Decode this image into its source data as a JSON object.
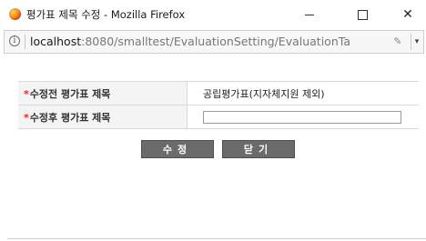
{
  "window": {
    "title": "평가표 제목 수정 - Mozilla Firefox",
    "minimize_glyph": "—",
    "maximize_glyph": "☐",
    "close_glyph": "✕"
  },
  "urlbar": {
    "host": "localhost",
    "rest": ":8080/smalltest/EvaluationSetting/EvaluationTa",
    "info_glyph": "i"
  },
  "form": {
    "rows": [
      {
        "required_mark": "*",
        "label": "수정전 평가표 제목",
        "value": "공립평가표(지자체지원 제외)"
      },
      {
        "required_mark": "*",
        "label": "수정후 평가표 제목",
        "input_value": ""
      }
    ]
  },
  "buttons": {
    "save_label": "수정",
    "close_label": "닫기"
  }
}
